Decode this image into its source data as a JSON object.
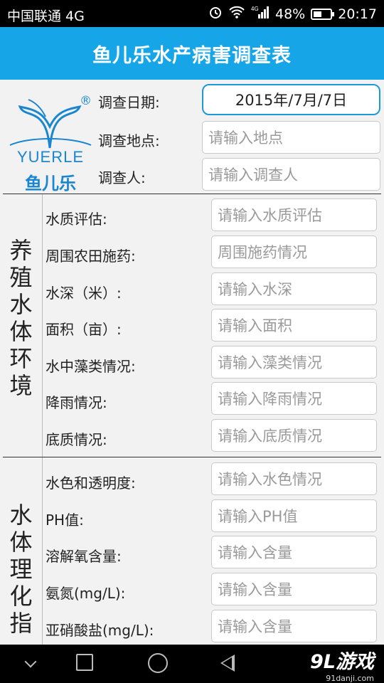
{
  "status_bar": {
    "carrier": "中国联通 4G",
    "network": "4G",
    "battery": "48%",
    "battery_level": 0.48,
    "time": "20:17"
  },
  "app": {
    "title": "鱼儿乐水产病害调查表"
  },
  "logo": {
    "registered": "®",
    "brand_en": "YUERLE",
    "brand_cn": "鱼儿乐"
  },
  "header": {
    "date_label": "调查日期:",
    "date_value": "2015年/7月/7日",
    "location_label": "调查地点:",
    "location_placeholder": "请输入地点",
    "investigator_label": "调查人:",
    "investigator_placeholder": "请输入调查人"
  },
  "sections": [
    {
      "title_chars": [
        "养",
        "殖",
        "水",
        "体",
        "环",
        "境"
      ],
      "rows": [
        {
          "label": "水质评估:",
          "placeholder": "请输入水质评估"
        },
        {
          "label": "周围农田施药:",
          "placeholder": "周围施药情况"
        },
        {
          "label": "水深（米）:",
          "placeholder": "请输入水深"
        },
        {
          "label": "面积（亩）:",
          "placeholder": "请输入面积"
        },
        {
          "label": "水中藻类情况:",
          "placeholder": "请输入藻类情况"
        },
        {
          "label": "降雨情况:",
          "placeholder": "请输入降雨情况"
        },
        {
          "label": "底质情况:",
          "placeholder": "请输入底质情况"
        }
      ]
    },
    {
      "title_chars": [
        "水",
        "体",
        "理",
        "化",
        "指"
      ],
      "rows": [
        {
          "label": "水色和透明度:",
          "placeholder": "请输入水色情况"
        },
        {
          "label": "PH值:",
          "placeholder": "请输入PH值"
        },
        {
          "label": "溶解氧含量:",
          "placeholder": "请输入含量"
        },
        {
          "label": "氨氮(mg/L):",
          "placeholder": "请输入含量"
        },
        {
          "label": "亚硝酸盐(mg/L):",
          "placeholder": "请输入含量"
        }
      ]
    }
  ],
  "watermark": {
    "brand": "9L游戏",
    "site": "91danji.com"
  }
}
